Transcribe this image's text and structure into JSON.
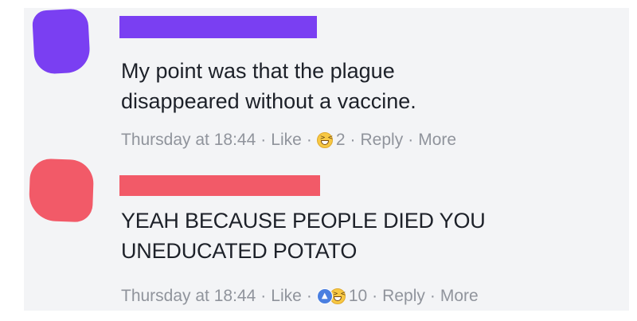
{
  "colors": {
    "panel_background": "#f3f4f6",
    "comment1_redaction": "#7a3ff2",
    "comment2_redaction": "#f25a68",
    "meta_text": "#90949c",
    "body_text": "#1d2129"
  },
  "comments": [
    {
      "body_lines": [
        "My point was that the plague",
        "disappeared without a vaccine."
      ],
      "time": "Thursday at 18:44",
      "like_label": "Like",
      "reaction_icons": [
        "haha-emoji-icon"
      ],
      "reaction_count": "2",
      "reply_label": "Reply",
      "more_label": "More"
    },
    {
      "body_lines": [
        "YEAH BECAUSE PEOPLE DIED YOU",
        "UNEDUCATED POTATO"
      ],
      "time": "Thursday at 18:44",
      "like_label": "Like",
      "reaction_icons": [
        "like-thumb-icon",
        "haha-emoji-icon"
      ],
      "reaction_count": "10",
      "reply_label": "Reply",
      "more_label": "More"
    }
  ],
  "separator": "·"
}
